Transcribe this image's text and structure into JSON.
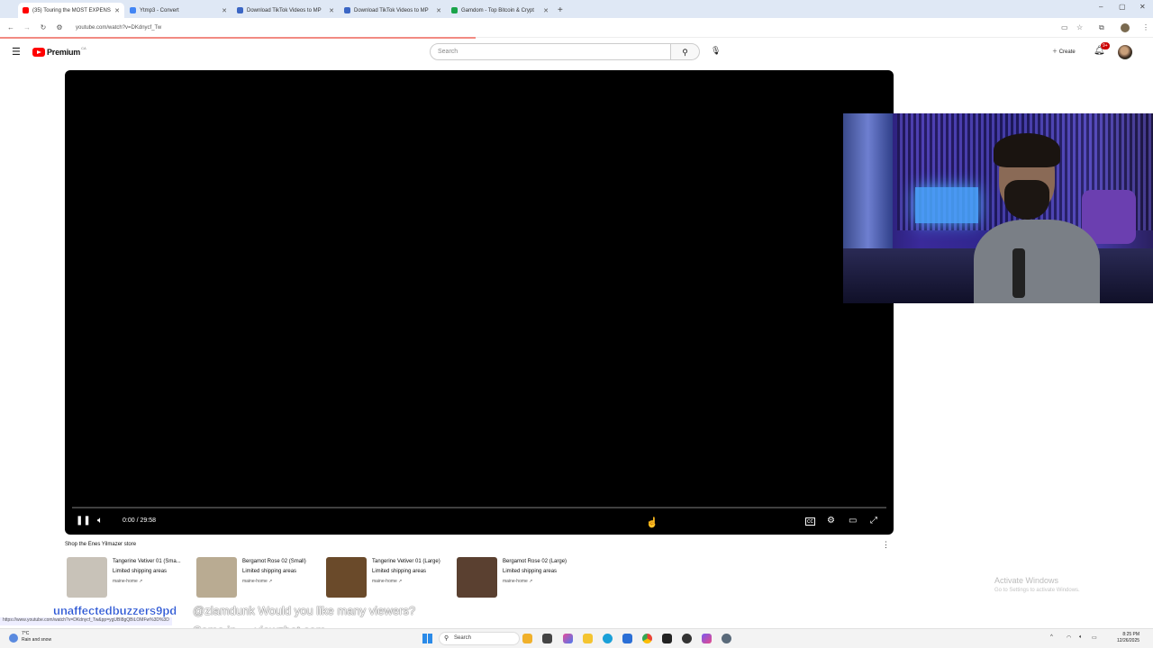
{
  "browser": {
    "tabs": [
      {
        "title": "(35) Touring the MOST EXPENS",
        "active": true,
        "favicon_color": "#ff0000"
      },
      {
        "title": "Ytmp3 - Convert",
        "active": false,
        "favicon_color": "#4285f4"
      },
      {
        "title": "Download TikTok Videos to MP",
        "active": false,
        "favicon_color": "#3b66c4"
      },
      {
        "title": "Download TikTok Videos to MP",
        "active": false,
        "favicon_color": "#3b66c4"
      },
      {
        "title": "Gamdom - Top Bitcoin & Crypt",
        "active": false,
        "favicon_color": "#1aa34a"
      }
    ],
    "url": "youtube.com/watch?v=DKdnycf_Tw",
    "status_url": "https://www.youtube.com/watch?v=DKdnycf_Tw&pp=ygUBI8gQBiLOMFw%3D%3D"
  },
  "youtube": {
    "logo_text": "Premium",
    "logo_region": "CA",
    "search_placeholder": "Search",
    "create_label": "Create",
    "notification_count": "9+"
  },
  "player": {
    "time_display": "0:00 / 29:58",
    "state": "playing",
    "progress": 0
  },
  "shop": {
    "title": "Shop the Enes Yilmazer store",
    "products": [
      {
        "name": "Tangerine Vetiver 01 (Sma...",
        "shipping": "Limited shipping areas",
        "store": "maine-home ↗",
        "thumb_color": "#c8c2b8"
      },
      {
        "name": "Bergamot Rose 02 (Small)",
        "shipping": "Limited shipping areas",
        "store": "maine-home ↗",
        "thumb_color": "#b9ab92"
      },
      {
        "name": "Tangerine Vetiver 01 (Large)",
        "shipping": "Limited shipping areas",
        "store": "maine-home ↗",
        "thumb_color": "#6a4a2a"
      },
      {
        "name": "Bergamot Rose 02 (Large)",
        "shipping": "Limited shipping areas",
        "store": "maine-home ↗",
        "thumb_color": "#5a4030"
      }
    ]
  },
  "overlay_chat": {
    "username": "unaffectedbuzzers9pd",
    "message": "@zlamdunk Would you like many viewers?",
    "subtext": "Come in — viewzbot.com"
  },
  "activation": {
    "line1": "Activate Windows",
    "line2": "Go to Settings to activate Windows."
  },
  "taskbar": {
    "weather_temp": "7°C",
    "weather_desc": "Rain and snow",
    "search_label": "Search",
    "time": "8:25 PM",
    "date": "12/26/2025"
  }
}
